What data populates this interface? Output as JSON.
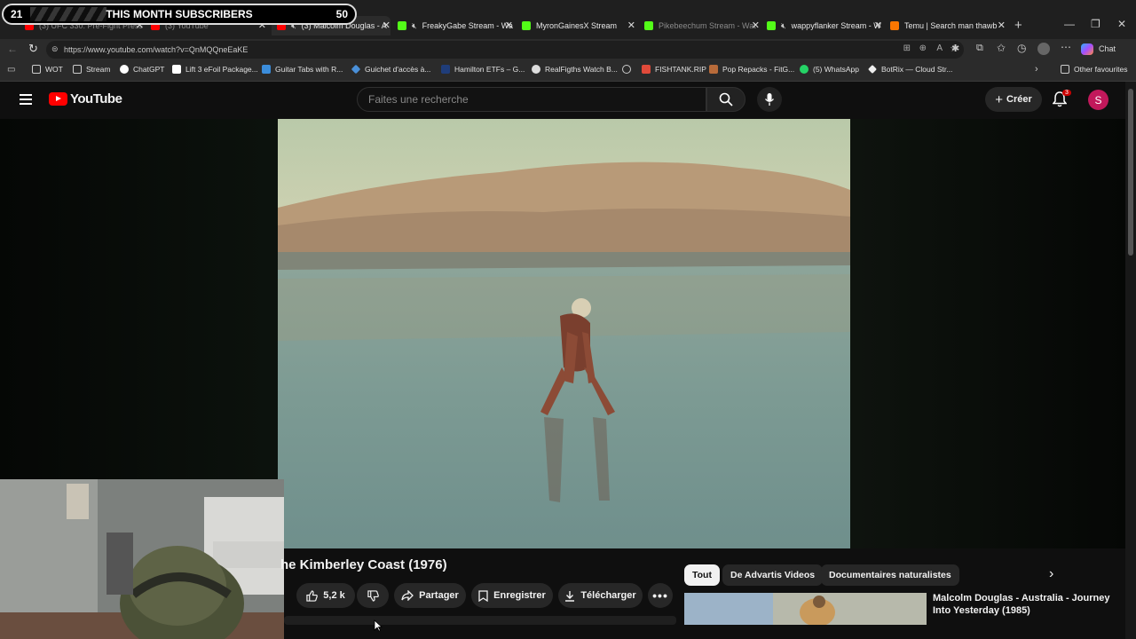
{
  "overlay": {
    "left_count": "21",
    "label": "THIS MONTH SUBSCRIBERS",
    "right_count": "50"
  },
  "tabs": [
    {
      "label": "(3) UFC 330: Pre-Fight Press",
      "favicon_color": "#ff0000"
    },
    {
      "label": "(3) YouTube",
      "favicon_color": "#ff0000"
    },
    {
      "label": "(3) Malcolm Douglas - A",
      "favicon_color": "#ff0000",
      "muted": true,
      "active": true
    },
    {
      "label": "FreakyGabe Stream - Wa",
      "favicon_color": "#53fc18",
      "muted": true
    },
    {
      "label": "MyronGainesX Stream",
      "favicon_color": "#53fc18"
    },
    {
      "label": "Pikebeechum Stream - Wat",
      "favicon_color": "#53fc18"
    },
    {
      "label": "wappyflanker Stream - W",
      "favicon_color": "#53fc18",
      "muted": true
    },
    {
      "label": "Temu | Search man thawb",
      "favicon_color": "#fb7701"
    }
  ],
  "address": {
    "url": "https://www.youtube.com/watch?v=QnMQQneEaKE",
    "chat_label": "Chat"
  },
  "bookmarks": [
    {
      "label": "WOT",
      "icon": "folder-icon"
    },
    {
      "label": "Stream",
      "icon": "folder-icon"
    },
    {
      "label": "ChatGPT",
      "icon": "chatgpt-icon"
    },
    {
      "label": "Lift 3 eFoil Package...",
      "icon": "lift-icon"
    },
    {
      "label": "Guitar Tabs with R...",
      "icon": "guitar-icon"
    },
    {
      "label": "Guichet d'accès à...",
      "icon": "gov-icon"
    },
    {
      "label": "Hamilton ETFs – G...",
      "icon": "hamilton-icon"
    },
    {
      "label": "RealFigths Watch B...",
      "icon": "wordpress-icon"
    },
    {
      "label": "",
      "icon": "globe-icon"
    },
    {
      "label": "FISHTANK.RIP",
      "icon": "fish-icon"
    },
    {
      "label": "Pop Repacks - FitG...",
      "icon": "fitgirl-icon"
    },
    {
      "label": "(5) WhatsApp",
      "icon": "whatsapp-icon"
    },
    {
      "label": "BotRix — Cloud Str...",
      "icon": "botrix-icon"
    }
  ],
  "other_favourites": "Other favourites",
  "youtube": {
    "logo_text": "YouTube",
    "search_placeholder": "Faites une recherche",
    "create_label": "Créer",
    "notifications_count": "3",
    "avatar_letter": "S"
  },
  "video": {
    "title": "he Kimberley Coast (1976)",
    "likes": "5,2 k",
    "share_label": "Partager",
    "save_label": "Enregistrer",
    "download_label": "Télécharger"
  },
  "chips": [
    "Tout",
    "De Advartis Videos",
    "Documentaires naturalistes"
  ],
  "related": {
    "title": "Malcolm Douglas - Australia - Journey Into Yesterday  (1985)"
  }
}
